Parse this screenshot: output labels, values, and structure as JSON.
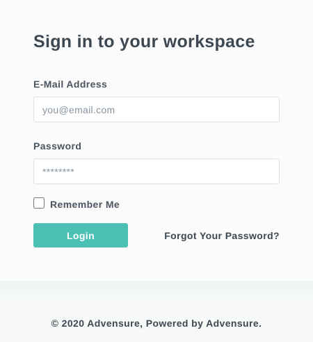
{
  "form": {
    "title": "Sign in to your workspace",
    "email_label": "E-Mail Address",
    "email_placeholder": "you@email.com",
    "email_value": "",
    "password_label": "Password",
    "password_placeholder": "********",
    "password_value": "",
    "remember_label": "Remember Me",
    "remember_checked": false,
    "login_label": "Login",
    "forgot_label": "Forgot Your Password?"
  },
  "footer": {
    "text": "© 2020 Advensure, Powered by Advensure."
  },
  "colors": {
    "accent": "#4dc0b5",
    "text": "#3d4852",
    "background": "#f7f9f9"
  }
}
